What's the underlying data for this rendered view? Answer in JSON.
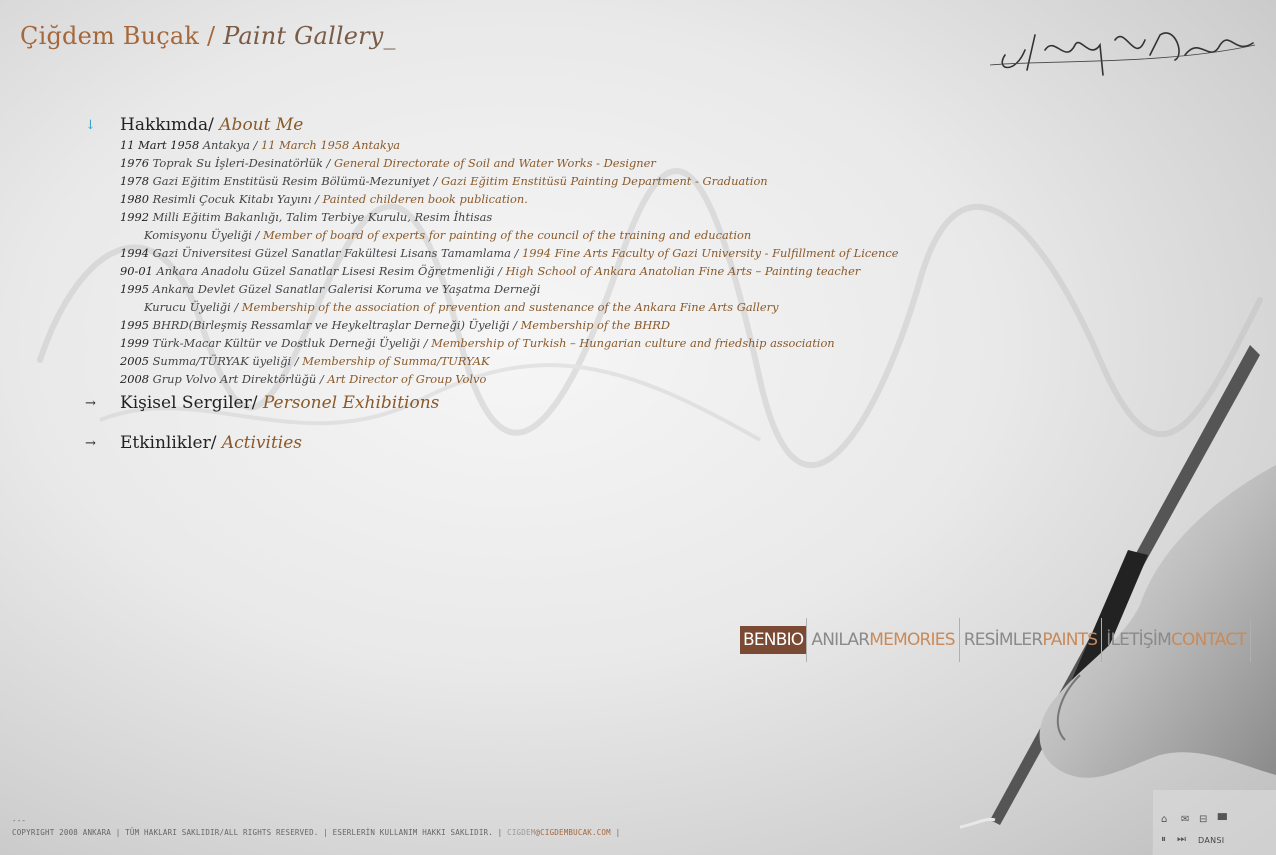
{
  "header": {
    "name": "Çiğdem Buçak",
    "separator": " / ",
    "gallery": "Paint Gallery_"
  },
  "sections": {
    "about": {
      "tr": "Hakkımda/ ",
      "en": "About Me"
    },
    "exhibitions": {
      "tr": "Kişisel Sergiler/ ",
      "en": "Personel Exhibitions"
    },
    "activities": {
      "tr": "Etkinlikler/ ",
      "en": "Activities"
    }
  },
  "icons": {
    "active_arrow": "↓",
    "arrow": "→"
  },
  "entries": [
    {
      "yr": "11 Mart 1958",
      "tr": "   Antakya  / ",
      "en": " 11 March 1958 Antakya"
    },
    {
      "yr": "1976",
      "tr": " Toprak Su İşleri-Desinatörlük  / ",
      "en": "General Directorate of Soil and Water Works - Designer"
    },
    {
      "yr": "1978",
      "tr": " Gazi Eğitim Enstitüsü Resim Bölümü-Mezuniyet  /  ",
      "en": "Gazi Eğitim Enstitüsü Painting  Department - Graduation"
    },
    {
      "yr": "1980",
      "tr": " Resimli Çocuk Kitabı Yayını /  ",
      "en": "Painted childeren book publication."
    },
    {
      "yr": "1992",
      "tr": " Milli Eğitim Bakanlığı, Talim Terbiye Kurulu, Resim İhtisas",
      "en": ""
    },
    {
      "yr": "",
      "tr": "Komisyonu Üyeliği / ",
      "en": "Member of board of experts for painting of the council of the training and education",
      "indent": true
    },
    {
      "yr": "1994",
      "tr": " Gazi Üniversitesi Güzel Sanatlar Fakültesi Lisans Tamamlama  /  ",
      "en": "1994 Fine Arts Faculty of Gazi University - Fulfillment of Licence"
    },
    {
      "yr": "90-01",
      "tr": " Ankara Anadolu Güzel Sanatlar Lisesi Resim Öğretmenliği  /  ",
      "en": "High School of Ankara Anatolian Fine Arts – Painting teacher"
    },
    {
      "yr": "1995",
      "tr": "  Ankara Devlet Güzel Sanatlar Galerisi Koruma ve Yaşatma Derneği",
      "en": ""
    },
    {
      "yr": "",
      "tr": "Kurucu Üyeliği / ",
      "en": "Membership of the association of prevention and sustenance of the Ankara Fine Arts Gallery",
      "indent": true
    },
    {
      "yr": "1995",
      "tr": " BHRD(Birleşmiş Ressamlar ve Heykeltraşlar Derneği) Üyeliği / ",
      "en": "Membership of the BHRD"
    },
    {
      "yr": "1999",
      "tr": " Türk-Macar Kültür ve Dostluk Derneği Üyeliği / ",
      "en": "Membership of Turkish – Hungarian culture and friedship association"
    },
    {
      "yr": "2005",
      "tr": " Summa/TÜRYAK üyeliği / ",
      "en": "Membership of  Summa/TURYAK"
    },
    {
      "yr": "2008",
      "tr": " Grup Volvo Art Direktörlüğü / ",
      "en": "Art Director of Group Volvo"
    }
  ],
  "nav": [
    {
      "tr": "BEN",
      "en": "BIO",
      "active": true
    },
    {
      "tr": "ANILAR",
      "en": "MEMORIES"
    },
    {
      "tr": "RESİMLER",
      "en": "PAINTS"
    },
    {
      "tr": "İLETİŞİM",
      "en": "CONTACT"
    }
  ],
  "footer": {
    "dash": "---",
    "copyright": "COPYRIGHT 2008 ANKARA  | TÜM HAKLARI SAKLIDIR/ALL RIGHTS RESERVED.  |  ESERLERİN KULLANIM HAKKI SAKLIDIR.  |   ",
    "email_prefix": "CIGDEM",
    "email": "@CIGDEMBUCAK.COM",
    "end": " |"
  },
  "player": {
    "label": "DANSI",
    "pause": "⏸",
    "next": "⏭",
    "home": "⌂",
    "mail": "✉",
    "minus": "⊟",
    "eq": "▮▮▮"
  }
}
